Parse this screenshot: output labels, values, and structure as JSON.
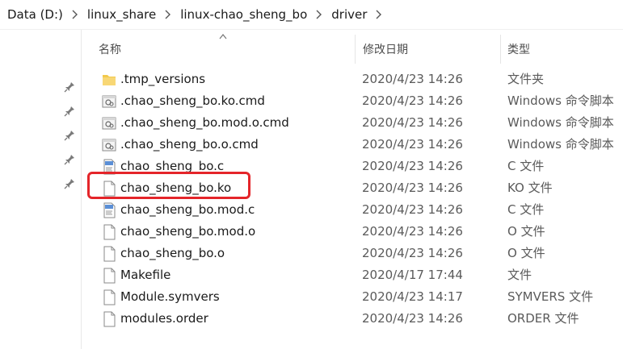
{
  "breadcrumb": [
    "Data (D:)",
    "linux_share",
    "linux-chao_sheng_bo",
    "driver"
  ],
  "columns": {
    "name": "名称",
    "date": "修改日期",
    "type": "类型"
  },
  "files": [
    {
      "name": ".tmp_versions",
      "date": "2020/4/23 14:26",
      "type": "文件夹",
      "icon": "folder-icon"
    },
    {
      "name": ".chao_sheng_bo.ko.cmd",
      "date": "2020/4/23 14:26",
      "type": "Windows 命令脚本",
      "icon": "cmd-script-icon"
    },
    {
      "name": ".chao_sheng_bo.mod.o.cmd",
      "date": "2020/4/23 14:26",
      "type": "Windows 命令脚本",
      "icon": "cmd-script-icon"
    },
    {
      "name": ".chao_sheng_bo.o.cmd",
      "date": "2020/4/23 14:26",
      "type": "Windows 命令脚本",
      "icon": "cmd-script-icon"
    },
    {
      "name": "chao_sheng_bo.c",
      "date": "2020/4/23 14:26",
      "type": "C 文件",
      "icon": "c-source-icon"
    },
    {
      "name": "chao_sheng_bo.ko",
      "date": "2020/4/23 14:26",
      "type": "KO 文件",
      "icon": "generic-file-icon"
    },
    {
      "name": "chao_sheng_bo.mod.c",
      "date": "2020/4/23 14:26",
      "type": "C 文件",
      "icon": "c-source-icon"
    },
    {
      "name": "chao_sheng_bo.mod.o",
      "date": "2020/4/23 14:26",
      "type": "O 文件",
      "icon": "generic-file-icon"
    },
    {
      "name": "chao_sheng_bo.o",
      "date": "2020/4/23 14:26",
      "type": "O 文件",
      "icon": "generic-file-icon"
    },
    {
      "name": "Makefile",
      "date": "2020/4/17 17:44",
      "type": "文件",
      "icon": "generic-file-icon"
    },
    {
      "name": "Module.symvers",
      "date": "2020/4/23 14:17",
      "type": "SYMVERS 文件",
      "icon": "generic-file-icon"
    },
    {
      "name": "modules.order",
      "date": "2020/4/23 14:26",
      "type": "ORDER 文件",
      "icon": "generic-file-icon"
    }
  ],
  "colors": {
    "highlight": "#e4252a",
    "folder": "#f2c94c"
  }
}
